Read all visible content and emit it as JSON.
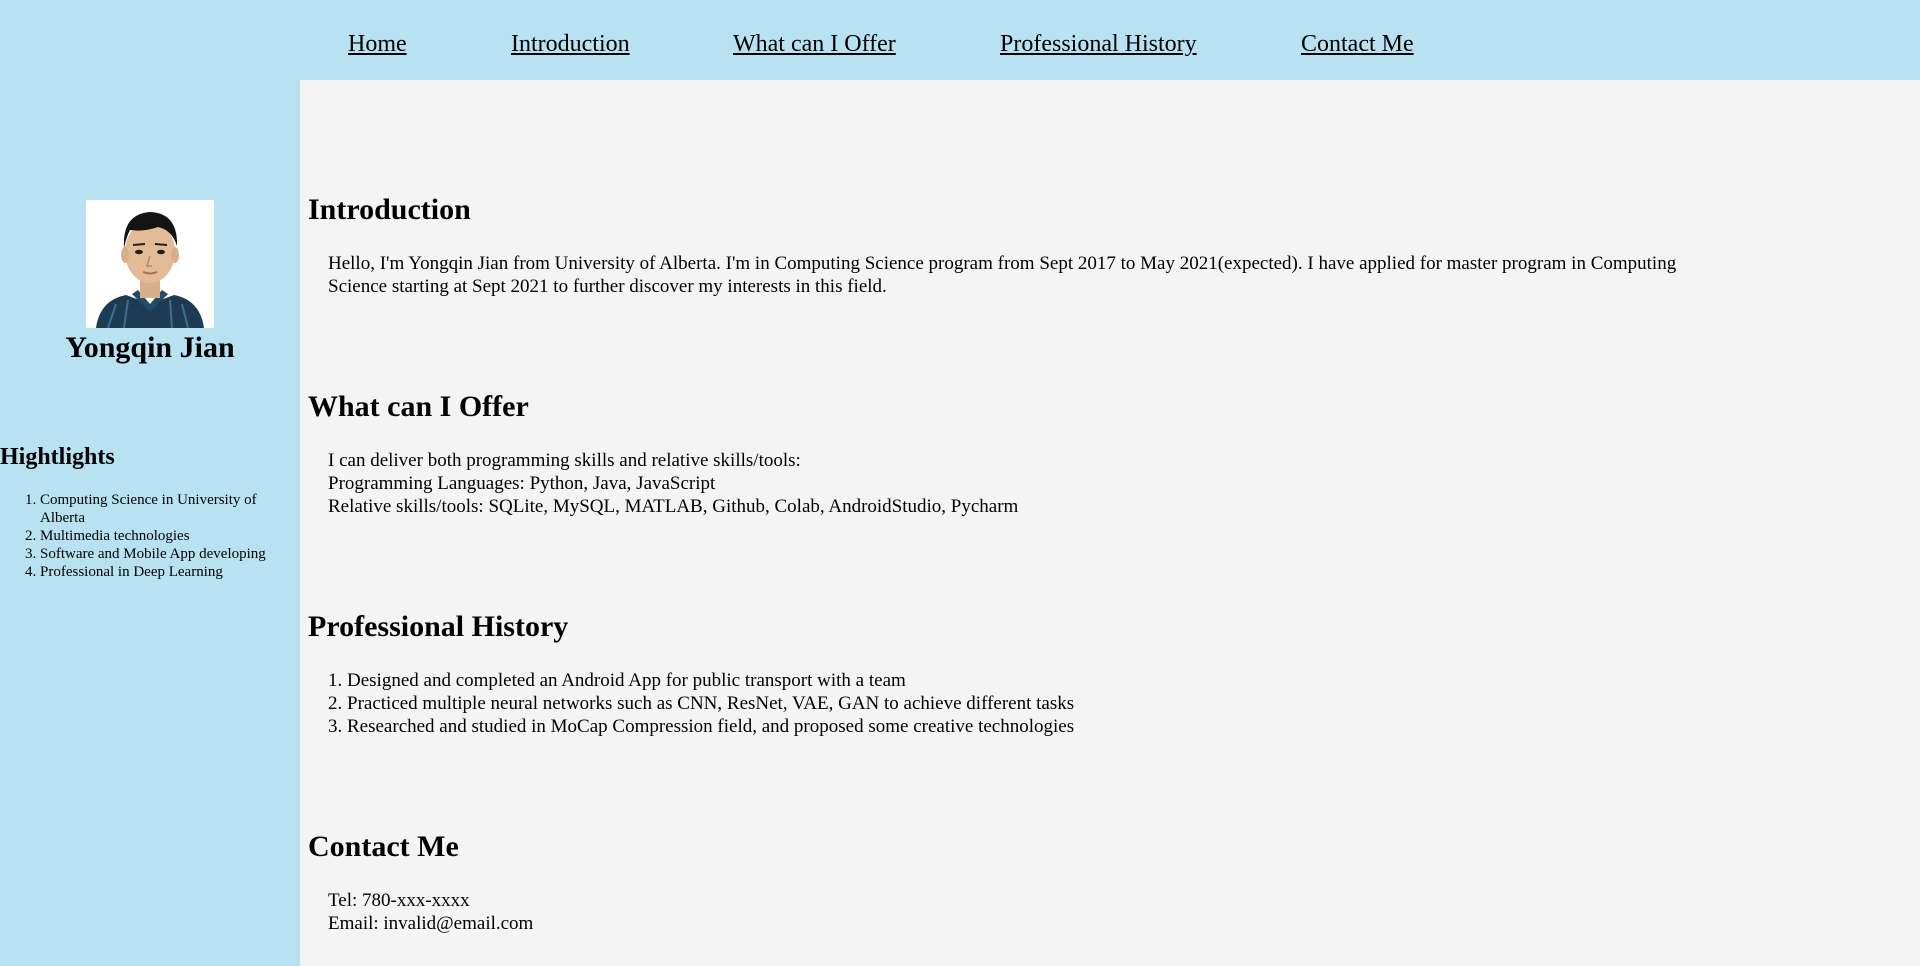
{
  "nav": {
    "items": [
      {
        "label": "Home"
      },
      {
        "label": "Introduction"
      },
      {
        "label": "What can I Offer"
      },
      {
        "label": "Professional History"
      },
      {
        "label": "Contact Me"
      }
    ]
  },
  "sidebar": {
    "name": "Yongqin Jian",
    "highlights_title": "Hightlights",
    "highlights": [
      "Computing Science in University of Alberta",
      "Multimedia technologies",
      "Software and Mobile App developing",
      "Professional in Deep Learning"
    ]
  },
  "introduction": {
    "title": "Introduction",
    "text": "Hello, I'm Yongqin Jian from University of Alberta. I'm in Computing Science program from Sept 2017 to May 2021(expected). I have applied for master program in Computing Science starting at Sept 2021 to further discover my interests in this field."
  },
  "offer": {
    "title": "What can I Offer",
    "lines": [
      "I can deliver both programming skills and relative skills/tools:",
      "Programming Languages: Python, Java, JavaScript",
      "Relative skills/tools: SQLite, MySQL, MATLAB, Github, Colab, AndroidStudio, Pycharm"
    ]
  },
  "history": {
    "title": "Professional History",
    "items": [
      "1. Designed and completed an Android App for public transport with a team",
      "2. Practiced multiple neural networks such as CNN, ResNet, VAE, GAN to achieve different tasks",
      "3. Researched and studied in MoCap Compression field, and proposed some creative technologies"
    ]
  },
  "contact": {
    "title": "Contact Me",
    "lines": [
      "Tel: 780-xxx-xxxx",
      "Email: invalid@email.com"
    ]
  }
}
